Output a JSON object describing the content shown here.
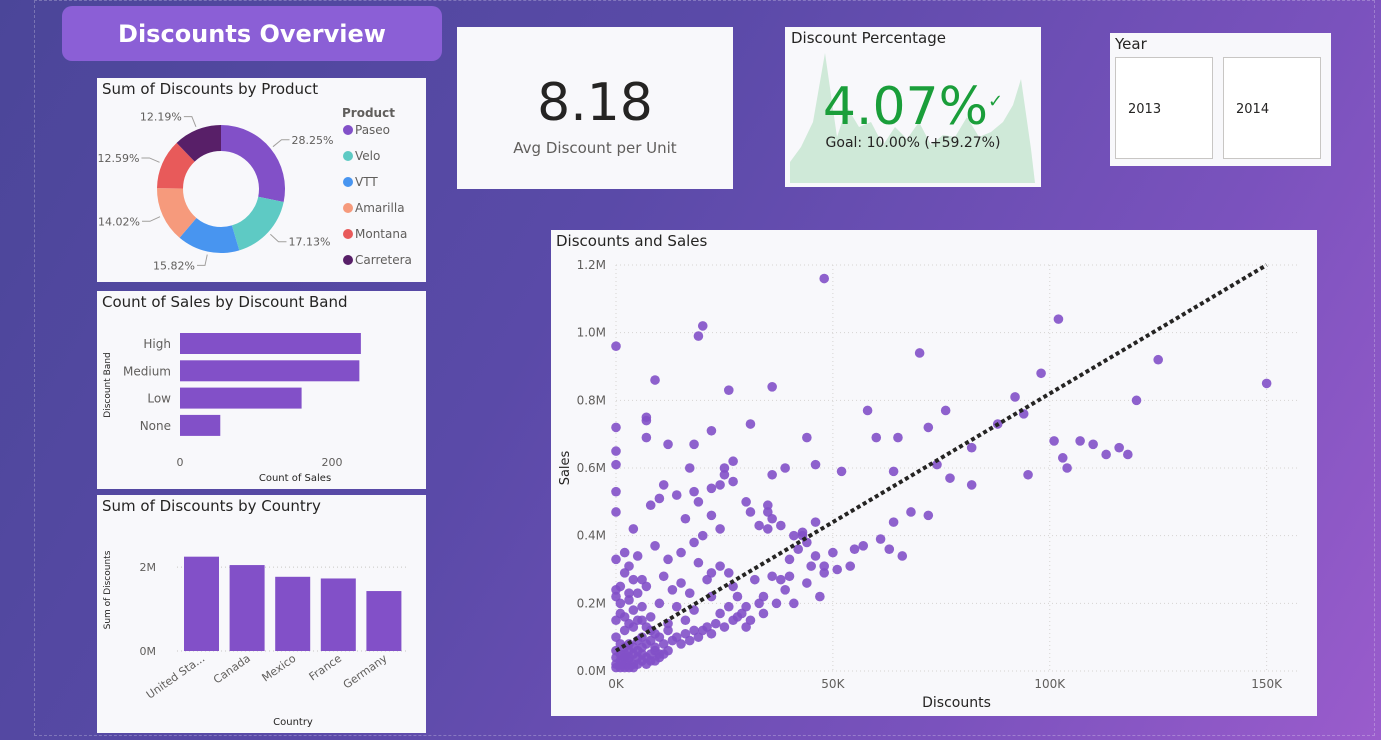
{
  "page": {
    "title": "Discounts Overview"
  },
  "kpi_avg": {
    "value": "8.18",
    "label": "Avg Discount per Unit"
  },
  "kpi_pct": {
    "title": "Discount Percentage",
    "value": "4.07%",
    "goal": "Goal: 10.00% (+59.27%)"
  },
  "year_slicer": {
    "title": "Year",
    "options": [
      "2013",
      "2014"
    ]
  },
  "colors": {
    "accent": "#8250c8",
    "kpi_green": "#1a9e3a",
    "kpi_area": "#cfe9d8"
  },
  "chart_data": [
    {
      "type": "pie",
      "title": "Sum of Discounts by Product",
      "legend_title": "Product",
      "legend_position": "right",
      "categories": [
        "Paseo",
        "Velo",
        "VTT",
        "Amarilla",
        "Montana",
        "Carretera"
      ],
      "values": [
        28.25,
        17.13,
        15.82,
        14.02,
        12.59,
        12.19
      ],
      "labels": [
        "28.25%",
        "17.13%",
        "15.82%",
        "14.02%",
        "12.59%",
        "12.19%"
      ],
      "colors": [
        "#8250c8",
        "#5ecac4",
        "#4895f0",
        "#f69a7c",
        "#e85a5a",
        "#581f68"
      ]
    },
    {
      "type": "bar",
      "orientation": "horizontal",
      "title": "Count of Sales by Discount Band",
      "categories": [
        "High",
        "Medium",
        "Low",
        "None"
      ],
      "values": [
        238,
        236,
        160,
        53
      ],
      "xlabel": "Count of Sales",
      "ylabel": "Discount Band",
      "ticks": [
        "0",
        "200"
      ],
      "xlim": [
        0,
        300
      ],
      "grid": false
    },
    {
      "type": "bar",
      "title": "Sum of Discounts by Country",
      "categories": [
        "United Sta...",
        "Canada",
        "Mexico",
        "France",
        "Germany"
      ],
      "values": [
        2.25,
        2.05,
        1.77,
        1.73,
        1.43
      ],
      "xlabel": "Country",
      "ylabel": "Sum of Discounts",
      "ticks": [
        "0M",
        "2M"
      ],
      "ylim": [
        0,
        2.6
      ],
      "grid": true
    },
    {
      "type": "scatter",
      "title": "Discounts and Sales",
      "xlabel": "Discounts",
      "ylabel": "Sales",
      "xticks": [
        "0K",
        "50K",
        "100K",
        "150K"
      ],
      "yticks": [
        "0.0M",
        "0.2M",
        "0.4M",
        "0.6M",
        "0.8M",
        "1.0M",
        "1.2M"
      ],
      "xlim": [
        0,
        157
      ],
      "ylim": [
        0,
        1.2
      ],
      "grid": true,
      "trend_line": {
        "from": [
          0,
          0.06
        ],
        "to": [
          150,
          1.2
        ]
      },
      "points": [
        [
          48,
          1.16
        ],
        [
          20,
          1.02
        ],
        [
          19,
          0.99
        ],
        [
          102,
          1.04
        ],
        [
          0,
          0.96
        ],
        [
          70,
          0.94
        ],
        [
          125,
          0.92
        ],
        [
          9,
          0.86
        ],
        [
          98,
          0.88
        ],
        [
          150,
          0.85
        ],
        [
          26,
          0.83
        ],
        [
          36,
          0.84
        ],
        [
          92,
          0.81
        ],
        [
          120,
          0.8
        ],
        [
          94,
          0.76
        ],
        [
          58,
          0.77
        ],
        [
          76,
          0.77
        ],
        [
          7,
          0.75
        ],
        [
          7,
          0.74
        ],
        [
          0,
          0.72
        ],
        [
          22,
          0.71
        ],
        [
          31,
          0.73
        ],
        [
          60,
          0.69
        ],
        [
          65,
          0.69
        ],
        [
          72,
          0.72
        ],
        [
          88,
          0.73
        ],
        [
          82,
          0.66
        ],
        [
          101,
          0.68
        ],
        [
          107,
          0.68
        ],
        [
          110,
          0.67
        ],
        [
          113,
          0.64
        ],
        [
          116,
          0.66
        ],
        [
          118,
          0.64
        ],
        [
          104,
          0.6
        ],
        [
          103,
          0.63
        ],
        [
          44,
          0.69
        ],
        [
          12,
          0.67
        ],
        [
          18,
          0.67
        ],
        [
          7,
          0.69
        ],
        [
          46,
          0.61
        ],
        [
          27,
          0.62
        ],
        [
          25,
          0.6
        ],
        [
          36,
          0.58
        ],
        [
          52,
          0.59
        ],
        [
          64,
          0.59
        ],
        [
          74,
          0.61
        ],
        [
          77,
          0.57
        ],
        [
          82,
          0.55
        ],
        [
          95,
          0.58
        ],
        [
          39,
          0.6
        ],
        [
          17,
          0.6
        ],
        [
          11,
          0.55
        ],
        [
          10,
          0.51
        ],
        [
          14,
          0.52
        ],
        [
          18,
          0.53
        ],
        [
          24,
          0.55
        ],
        [
          25,
          0.58
        ],
        [
          27,
          0.56
        ],
        [
          22,
          0.54
        ],
        [
          30,
          0.5
        ],
        [
          31,
          0.47
        ],
        [
          35,
          0.47
        ],
        [
          35,
          0.49
        ],
        [
          33,
          0.43
        ],
        [
          35,
          0.42
        ],
        [
          36,
          0.45
        ],
        [
          38,
          0.43
        ],
        [
          41,
          0.4
        ],
        [
          43,
          0.41
        ],
        [
          46,
          0.44
        ],
        [
          50,
          0.35
        ],
        [
          55,
          0.36
        ],
        [
          57,
          0.37
        ],
        [
          61,
          0.39
        ],
        [
          64,
          0.44
        ],
        [
          68,
          0.47
        ],
        [
          63,
          0.36
        ],
        [
          66,
          0.34
        ],
        [
          72,
          0.46
        ],
        [
          8,
          0.49
        ],
        [
          4,
          0.42
        ],
        [
          0,
          0.53
        ],
        [
          0,
          0.65
        ],
        [
          0,
          0.61
        ],
        [
          0,
          0.47
        ],
        [
          16,
          0.45
        ],
        [
          19,
          0.5
        ],
        [
          22,
          0.46
        ],
        [
          24,
          0.42
        ],
        [
          20,
          0.4
        ],
        [
          15,
          0.35
        ],
        [
          18,
          0.38
        ],
        [
          12,
          0.33
        ],
        [
          9,
          0.37
        ],
        [
          5,
          0.34
        ],
        [
          3,
          0.31
        ],
        [
          0,
          0.33
        ],
        [
          2,
          0.35
        ],
        [
          4,
          0.27
        ],
        [
          0,
          0.24
        ],
        [
          1,
          0.2
        ],
        [
          3,
          0.23
        ],
        [
          6,
          0.27
        ],
        [
          7,
          0.25
        ],
        [
          11,
          0.28
        ],
        [
          13,
          0.24
        ],
        [
          15,
          0.26
        ],
        [
          17,
          0.23
        ],
        [
          19,
          0.32
        ],
        [
          21,
          0.27
        ],
        [
          22,
          0.29
        ],
        [
          24,
          0.31
        ],
        [
          26,
          0.29
        ],
        [
          27,
          0.25
        ],
        [
          28,
          0.22
        ],
        [
          30,
          0.19
        ],
        [
          32,
          0.27
        ],
        [
          34,
          0.22
        ],
        [
          36,
          0.28
        ],
        [
          38,
          0.27
        ],
        [
          40,
          0.33
        ],
        [
          42,
          0.36
        ],
        [
          43,
          0.4
        ],
        [
          44,
          0.38
        ],
        [
          46,
          0.34
        ],
        [
          40,
          0.28
        ],
        [
          44,
          0.26
        ],
        [
          45,
          0.31
        ],
        [
          48,
          0.29
        ],
        [
          41,
          0.2
        ],
        [
          47,
          0.22
        ],
        [
          33,
          0.2
        ],
        [
          31,
          0.15
        ],
        [
          22,
          0.22
        ],
        [
          18,
          0.18
        ],
        [
          10,
          0.2
        ],
        [
          8,
          0.16
        ],
        [
          6,
          0.19
        ],
        [
          4,
          0.13
        ],
        [
          2,
          0.12
        ],
        [
          9,
          0.11
        ],
        [
          12,
          0.14
        ],
        [
          14,
          0.19
        ],
        [
          16,
          0.15
        ],
        [
          18,
          0.12
        ],
        [
          21,
          0.13
        ],
        [
          24,
          0.17
        ],
        [
          26,
          0.19
        ],
        [
          28,
          0.16
        ],
        [
          30,
          0.13
        ],
        [
          34,
          0.17
        ],
        [
          37,
          0.2
        ],
        [
          39,
          0.24
        ],
        [
          48,
          0.31
        ],
        [
          51,
          0.3
        ],
        [
          54,
          0.31
        ],
        [
          0,
          0.1
        ],
        [
          1,
          0.08
        ],
        [
          2,
          0.07
        ],
        [
          3,
          0.06
        ],
        [
          4,
          0.05
        ],
        [
          5,
          0.04
        ],
        [
          6,
          0.05
        ],
        [
          7,
          0.04
        ],
        [
          8,
          0.05
        ],
        [
          9,
          0.07
        ],
        [
          10,
          0.05
        ],
        [
          11,
          0.08
        ],
        [
          12,
          0.06
        ],
        [
          13,
          0.09
        ],
        [
          14,
          0.1
        ],
        [
          15,
          0.08
        ],
        [
          16,
          0.11
        ],
        [
          17,
          0.09
        ],
        [
          19,
          0.1
        ],
        [
          20,
          0.12
        ],
        [
          22,
          0.11
        ],
        [
          23,
          0.14
        ],
        [
          25,
          0.13
        ],
        [
          27,
          0.15
        ],
        [
          29,
          0.17
        ],
        [
          0,
          0.02
        ],
        [
          1,
          0.03
        ],
        [
          2,
          0.02
        ],
        [
          3,
          0.03
        ],
        [
          4,
          0.02
        ],
        [
          5,
          0.02
        ],
        [
          6,
          0.03
        ],
        [
          7,
          0.02
        ],
        [
          8,
          0.03
        ],
        [
          9,
          0.03
        ],
        [
          10,
          0.04
        ],
        [
          1,
          0.01
        ],
        [
          2,
          0.01
        ],
        [
          3,
          0.01
        ],
        [
          4,
          0.01
        ],
        [
          0,
          0.01
        ],
        [
          1,
          0.05
        ],
        [
          2,
          0.04
        ],
        [
          3,
          0.04
        ],
        [
          5,
          0.06
        ],
        [
          6,
          0.07
        ],
        [
          7,
          0.08
        ],
        [
          8,
          0.09
        ],
        [
          9,
          0.06
        ],
        [
          11,
          0.05
        ],
        [
          0,
          0.04
        ],
        [
          0,
          0.06
        ],
        [
          1,
          0.02
        ],
        [
          2,
          0.05
        ],
        [
          3,
          0.08
        ],
        [
          4,
          0.07
        ],
        [
          5,
          0.09
        ],
        [
          6,
          0.1
        ],
        [
          0,
          0.15
        ],
        [
          1,
          0.17
        ],
        [
          2,
          0.16
        ],
        [
          3,
          0.14
        ],
        [
          4,
          0.18
        ],
        [
          5,
          0.15
        ],
        [
          0,
          0.22
        ],
        [
          1,
          0.25
        ],
        [
          2,
          0.29
        ],
        [
          3,
          0.21
        ],
        [
          5,
          0.23
        ],
        [
          6,
          0.15
        ],
        [
          7,
          0.13
        ],
        [
          8,
          0.12
        ],
        [
          10,
          0.1
        ],
        [
          12,
          0.12
        ]
      ]
    }
  ]
}
